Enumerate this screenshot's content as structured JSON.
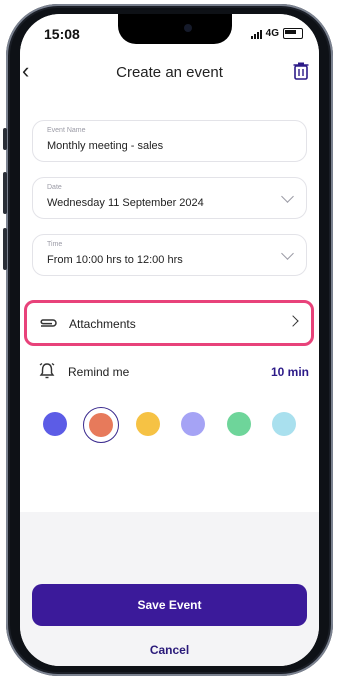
{
  "status": {
    "time": "15:08",
    "network": "4G"
  },
  "header": {
    "title": "Create an event"
  },
  "fields": {
    "event_name": {
      "label": "Event Name",
      "value": "Monthly meeting - sales"
    },
    "date": {
      "label": "Date",
      "value": "Wednesday 11 September 2024"
    },
    "time": {
      "label": "Time",
      "value": "From 10:00 hrs to 12:00 hrs"
    }
  },
  "attachments": {
    "label": "Attachments"
  },
  "remind": {
    "label": "Remind me",
    "value": "10 min"
  },
  "colors": [
    "#5c5ce6",
    "#e77a5b",
    "#f6c244",
    "#a5a3f5",
    "#6ed59a",
    "#a9e0ee"
  ],
  "selected_color_index": 1,
  "buttons": {
    "save": "Save Event",
    "cancel": "Cancel"
  },
  "theme": {
    "accent": "#3b1a9a",
    "highlight": "#e8427a"
  }
}
